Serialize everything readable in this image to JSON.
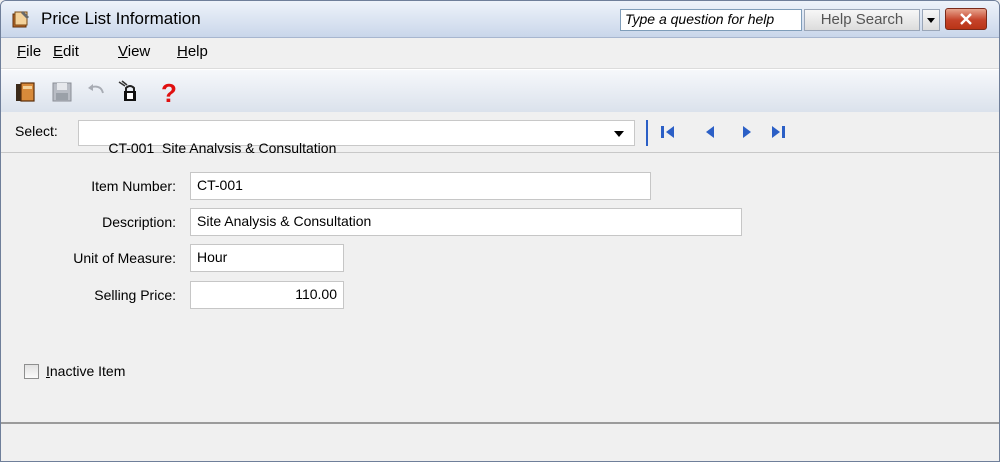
{
  "window": {
    "title": "Price List Information",
    "help_placeholder": "Type a question for help",
    "help_search_label": "Help Search"
  },
  "menu": {
    "items": [
      {
        "label": "File",
        "mnemonic": "F",
        "rest": "ile"
      },
      {
        "label": "Edit",
        "mnemonic": "E",
        "rest": "dit"
      },
      {
        "label": "View",
        "mnemonic": "V",
        "rest": "iew"
      },
      {
        "label": "Help",
        "mnemonic": "H",
        "rest": "elp"
      }
    ]
  },
  "toolbar": {
    "icons": [
      "close-book-icon",
      "save-disk-icon",
      "undo-icon",
      "security-padlock-icon",
      "help-question-icon"
    ]
  },
  "select_bar": {
    "label": "Select:",
    "value": "CT-001  Site Analysis & Consultation"
  },
  "form": {
    "item_number_label": "Item Number:",
    "item_number_value": "CT-001",
    "description_label": "Description:",
    "description_value": "Site Analysis & Consultation",
    "unit_label": "Unit of Measure:",
    "unit_value": "Hour",
    "price_label": "Selling Price:",
    "price_value": "110.00",
    "inactive_mnemonic": "I",
    "inactive_rest": "nactive Item",
    "inactive_checked": false
  },
  "colors": {
    "nav_blue": "#2b5fc6",
    "help_red": "#e01010",
    "close_red": "#c5432a"
  }
}
